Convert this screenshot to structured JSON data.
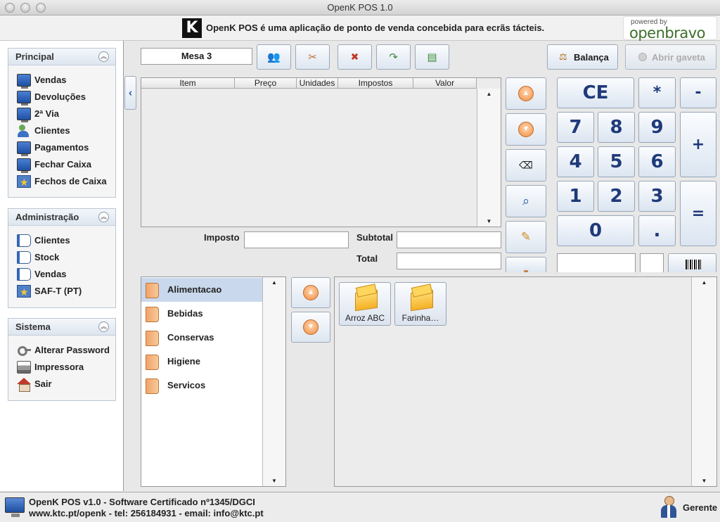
{
  "window": {
    "title": "OpenK POS 1.0"
  },
  "banner": {
    "logo_letter": "K",
    "tagline": "OpenK POS é uma aplicação de ponto de venda concebida para ecrãs tácteis.",
    "powered_by": "powered by",
    "brand": "openbravo"
  },
  "sidebar": {
    "sections": [
      {
        "title": "Principal",
        "items": [
          {
            "label": "Vendas",
            "icon": "monitor-icon"
          },
          {
            "label": "Devoluções",
            "icon": "monitor-icon"
          },
          {
            "label": "2ª Via",
            "icon": "monitor-icon"
          },
          {
            "label": "Clientes",
            "icon": "people-icon"
          },
          {
            "label": "Pagamentos",
            "icon": "monitor-icon"
          },
          {
            "label": "Fechar Caixa",
            "icon": "monitor-icon"
          },
          {
            "label": "Fechos de Caixa",
            "icon": "saft-icon"
          }
        ]
      },
      {
        "title": "Administração",
        "items": [
          {
            "label": "Clientes",
            "icon": "book-icon"
          },
          {
            "label": "Stock",
            "icon": "book-icon"
          },
          {
            "label": "Vendas",
            "icon": "book-icon"
          },
          {
            "label": "SAF-T (PT)",
            "icon": "saft-icon"
          }
        ]
      },
      {
        "title": "Sistema",
        "items": [
          {
            "label": "Alterar Password",
            "icon": "key-icon"
          },
          {
            "label": "Impressora",
            "icon": "printer-icon"
          },
          {
            "label": "Sair",
            "icon": "house-icon"
          }
        ]
      }
    ]
  },
  "toolbar": {
    "ticket_name": "Mesa 3",
    "balanca_label": "Balança",
    "abrir_gaveta_label": "Abrir gaveta"
  },
  "ticket_table": {
    "columns": [
      "Item",
      "Preço",
      "Unidades",
      "Impostos",
      "Valor"
    ],
    "rows": []
  },
  "totals": {
    "imposto_label": "Imposto",
    "subtotal_label": "Subtotal",
    "total_label": "Total",
    "imposto_value": "",
    "subtotal_value": "",
    "total_value": ""
  },
  "keypad": {
    "ce": "CE",
    "multiply": "*",
    "minus": "-",
    "plus": "+",
    "equals": "=",
    "seven": "7",
    "eight": "8",
    "nine": "9",
    "four": "4",
    "five": "5",
    "six": "6",
    "one": "1",
    "two": "2",
    "three": "3",
    "zero": "0",
    "dot": "."
  },
  "categories": [
    "Alimentacao",
    "Bebidas",
    "Conservas",
    "Higiene",
    "Servicos"
  ],
  "products": [
    "Arroz ABC",
    "Farinha…"
  ],
  "statusbar": {
    "line1": "OpenK POS v1.0 - Software Certificado nº1345/DGCI",
    "line2": "www.ktc.pt/openk - tel: 256184931 - email: info@ktc.pt",
    "user": "Gerente"
  },
  "colors": {
    "selection": "#c9d8ec",
    "accent_orange": "#f28a3c",
    "key_text": "#1f3a7a",
    "brand_green": "#3c6e2a"
  }
}
